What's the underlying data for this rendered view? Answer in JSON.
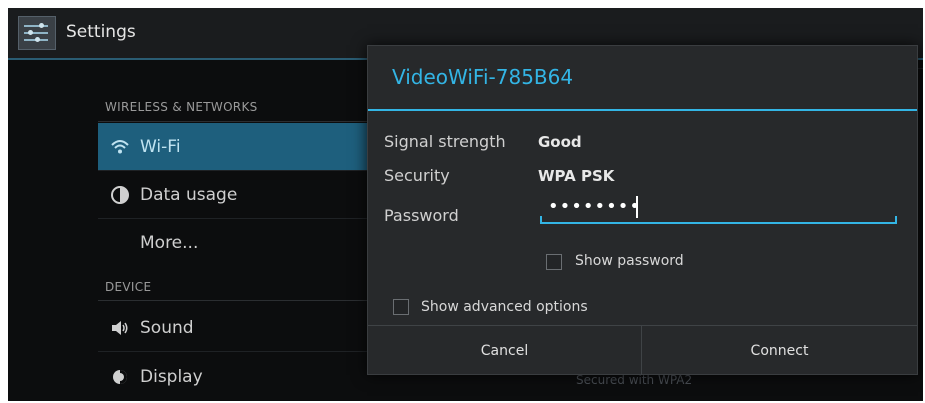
{
  "app": {
    "title": "Settings",
    "icon": "settings-sliders-icon"
  },
  "sidebar": {
    "sections": [
      {
        "header": "WIRELESS & NETWORKS"
      },
      {
        "header": "DEVICE"
      }
    ],
    "items": [
      {
        "label": "Wi-Fi",
        "icon": "wifi-icon",
        "selected": true
      },
      {
        "label": "Data usage",
        "icon": "data-usage-icon"
      },
      {
        "label": "More..."
      },
      {
        "label": "Sound",
        "icon": "volume-icon"
      },
      {
        "label": "Display",
        "icon": "brightness-icon"
      }
    ]
  },
  "background": {
    "network_status": "Secured with WPA2"
  },
  "dialog": {
    "title": "VideoWiFi-785B64",
    "signal_label": "Signal strength",
    "signal_value": "Good",
    "security_label": "Security",
    "security_value": "WPA PSK",
    "password_label": "Password",
    "password_value": "••••••••",
    "show_password_label": "Show password",
    "show_advanced_label": "Show advanced options",
    "cancel_label": "Cancel",
    "connect_label": "Connect"
  },
  "colors": {
    "accent": "#33b5e5",
    "selected_bg": "#1e5f7d",
    "dialog_bg": "#27292b"
  }
}
